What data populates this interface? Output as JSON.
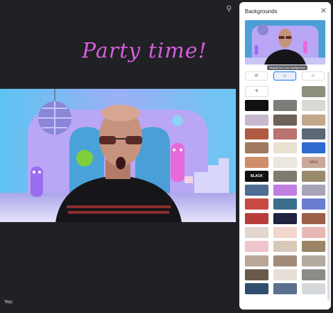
{
  "banner": {
    "text": "Party time!"
  },
  "participant": {
    "name": "You"
  },
  "panel": {
    "title": "Backgrounds",
    "close_icon": "close-icon",
    "tooltip": "Slightly blur your background",
    "controls": [
      {
        "icon": "no-effect-icon",
        "glyph": "⃠"
      },
      {
        "icon": "slight-blur-icon",
        "glyph": "☺"
      },
      {
        "icon": "blur-icon",
        "glyph": "☺"
      }
    ],
    "add_icon": "+",
    "tiles": [
      "#ffffff",
      "#8d8f7e",
      "#101012",
      "#7c7d78",
      "#d8d9d2",
      "#c7b7cf",
      "#6e6058",
      "#c1a98a",
      "#b05a43",
      "#b9726d",
      "#5b6876",
      "#a07a5f",
      "#e9e0d0",
      "#2d6bd1",
      "#cf8e6a",
      "#ebe7de",
      "#c9a89a",
      "#111111",
      "#7e7b6f",
      "#9a8a6c",
      "#4f6d92",
      "#c17fe0",
      "#a8a4b8",
      "#c84a45",
      "#3a6e8d",
      "#6c7cd1",
      "#b73c3c",
      "#1f2240",
      "#9a6148",
      "#e2d6cf",
      "#f2d6ce",
      "#e9b8b5",
      "#efc4cb",
      "#d8c8b7",
      "#9b8566",
      "#b9a79a",
      "#a28c79",
      "#b3aba1",
      "#6a5a4a",
      "#e6dfd6",
      "#8d8b86",
      "#2f4e6d",
      "#5d6f8e",
      "#d6d9db",
      "#8d978f",
      "#59527a",
      "#7d6ab0",
      "#99b59a"
    ],
    "blackfriday_text": "BLACK FRIDAY",
    "sale_text": "SALE"
  }
}
